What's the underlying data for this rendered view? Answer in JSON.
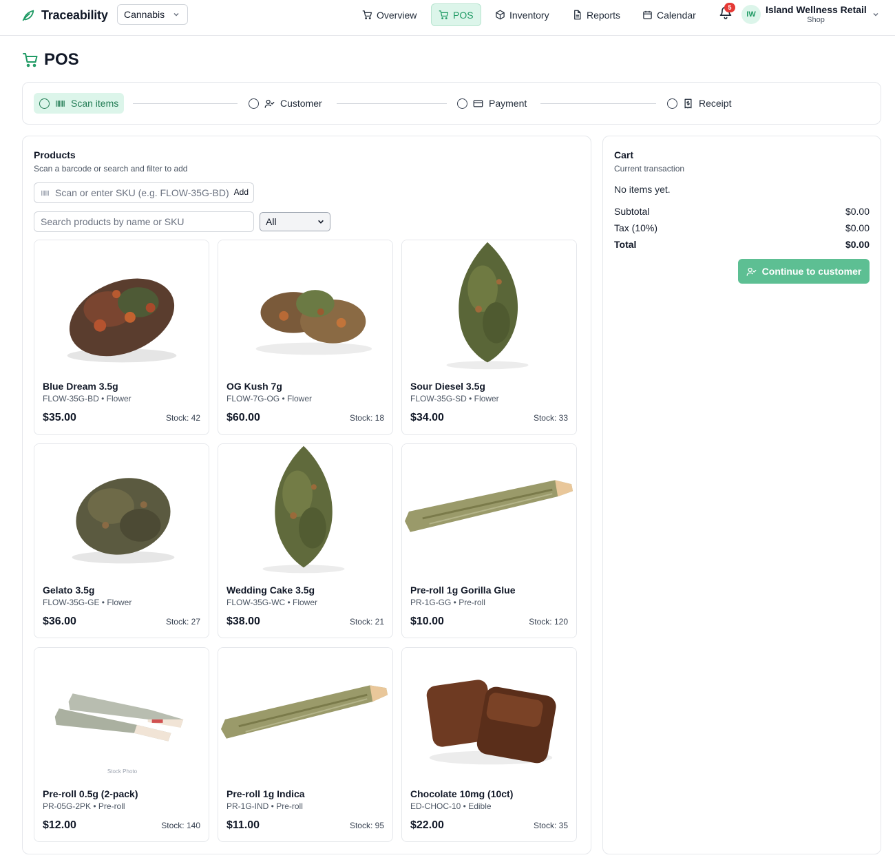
{
  "app": {
    "brand": "Traceability",
    "domain_select": "Cannabis",
    "nav": [
      {
        "label": "Overview",
        "icon": "cart-icon",
        "active": false
      },
      {
        "label": "POS",
        "icon": "cart-icon",
        "active": true
      },
      {
        "label": "Inventory",
        "icon": "box-icon",
        "active": false
      },
      {
        "label": "Reports",
        "icon": "document-icon",
        "active": false
      },
      {
        "label": "Calendar",
        "icon": "calendar-icon",
        "active": false
      }
    ],
    "notifications": "5",
    "user": {
      "initials": "IW",
      "org": "Island Wellness Retail",
      "role": "Shop"
    },
    "accent": "#1f9a64"
  },
  "page": {
    "title": "POS"
  },
  "stepper": [
    {
      "label": "Scan items",
      "icon": "barcode-icon",
      "active": true
    },
    {
      "label": "Customer",
      "icon": "user-check-icon",
      "active": false
    },
    {
      "label": "Payment",
      "icon": "credit-card-icon",
      "active": false
    },
    {
      "label": "Receipt",
      "icon": "receipt-icon",
      "active": false
    }
  ],
  "products": {
    "title": "Products",
    "subtitle": "Scan a barcode or search and filter to add",
    "scan_placeholder": "Scan or enter SKU (e.g. FLOW-35G-BD)",
    "scan_add": "Add",
    "search_placeholder": "Search products by name or SKU",
    "filter_value": "All",
    "items": [
      {
        "name": "Blue Dream 3.5g",
        "meta": "FLOW-35G-BD • Flower",
        "price": "$35.00",
        "stock": "Stock: 42",
        "image": "flower-image"
      },
      {
        "name": "OG Kush 7g",
        "meta": "FLOW-7G-OG • Flower",
        "price": "$60.00",
        "stock": "Stock: 18",
        "image": "flower-image"
      },
      {
        "name": "Sour Diesel 3.5g",
        "meta": "FLOW-35G-SD • Flower",
        "price": "$34.00",
        "stock": "Stock: 33",
        "image": "flower-image"
      },
      {
        "name": "Gelato 3.5g",
        "meta": "FLOW-35G-GE • Flower",
        "price": "$36.00",
        "stock": "Stock: 27",
        "image": "flower-image"
      },
      {
        "name": "Wedding Cake 3.5g",
        "meta": "FLOW-35G-WC • Flower",
        "price": "$38.00",
        "stock": "Stock: 21",
        "image": "flower-image"
      },
      {
        "name": "Pre-roll 1g Gorilla Glue",
        "meta": "PR-1G-GG • Pre-roll",
        "price": "$10.00",
        "stock": "Stock: 120",
        "image": "preroll-image"
      },
      {
        "name": "Pre-roll 0.5g (2-pack)",
        "meta": "PR-05G-2PK • Pre-roll",
        "price": "$12.00",
        "stock": "Stock: 140",
        "image": "preroll-pair-image",
        "image_caption": "Stock Photo"
      },
      {
        "name": "Pre-roll 1g Indica",
        "meta": "PR-1G-IND • Pre-roll",
        "price": "$11.00",
        "stock": "Stock: 95",
        "image": "preroll-image"
      },
      {
        "name": "Chocolate 10mg (10ct)",
        "meta": "ED-CHOC-10 • Edible",
        "price": "$22.00",
        "stock": "Stock: 35",
        "image": "chocolate-image"
      }
    ]
  },
  "cart": {
    "title": "Cart",
    "subtitle": "Current transaction",
    "empty": "No items yet.",
    "subtotal_label": "Subtotal",
    "subtotal": "$0.00",
    "tax_label": "Tax (10%)",
    "tax": "$0.00",
    "total_label": "Total",
    "total": "$0.00",
    "continue_label": "Continue to customer"
  }
}
